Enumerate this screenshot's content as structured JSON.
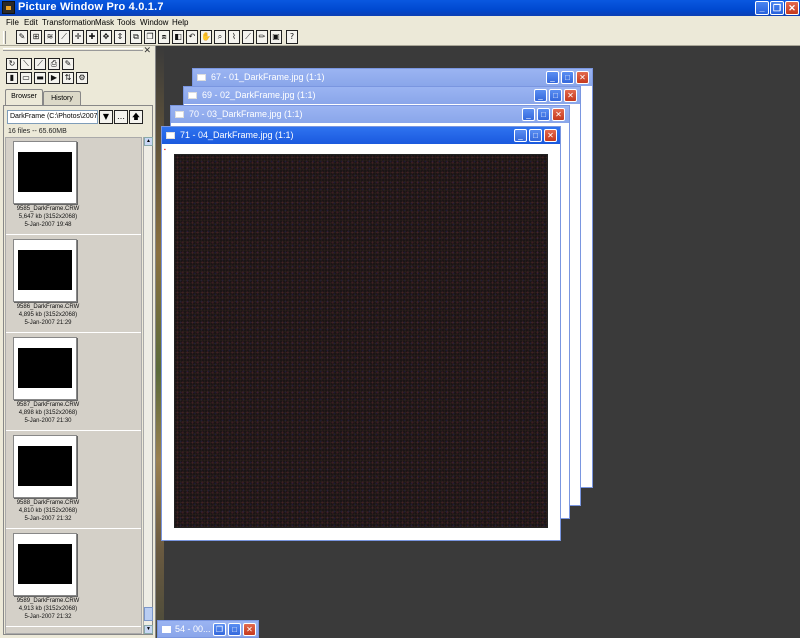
{
  "app": {
    "title": "Picture Window Pro 4.0.1.7"
  },
  "menu": [
    "File",
    "Edit",
    "Transformation",
    "Mask",
    "Tools",
    "Window",
    "Help"
  ],
  "toolbar_icons": [
    "pen-icon",
    "grid-icon",
    "wave-icon",
    "brush-icon",
    "cursor-icon",
    "plus-icon",
    "fit-icon",
    "range-icon",
    "layers-icon",
    "copy-icon",
    "stack-icon",
    "rotate-icon",
    "undo-icon",
    "hand-icon",
    "zoom-icon",
    "lasso-icon",
    "line-icon",
    "pencil-icon",
    "camera-icon",
    "help-icon"
  ],
  "toolbar_glyphs": [
    "✎",
    "⊞",
    "≋",
    "⟋",
    "✛",
    "✚",
    "✥",
    "⇕",
    "⧉",
    "❐",
    "⧈",
    "◧",
    "↶",
    "✋",
    "⌕",
    "⌇",
    "⟋",
    "✏",
    "▣",
    "?"
  ],
  "browser": {
    "tabs": [
      "Browser",
      "History"
    ],
    "folder": "DarkFrame (C:\\Photos\\2007",
    "file_count": "16 files -- 65.60MB",
    "files": [
      {
        "name": "9585_DarkFrame.CRW",
        "size": "5,647 kb (3152x2068)",
        "date": "5-Jan-2007 19:48"
      },
      {
        "name": "9586_DarkFrame.CRW",
        "size": "4,895 kb (3152x2068)",
        "date": "5-Jan-2007 21:29"
      },
      {
        "name": "9587_DarkFrame.CRW",
        "size": "4,898 kb (3152x2068)",
        "date": "5-Jan-2007 21:30"
      },
      {
        "name": "9588_DarkFrame.CRW",
        "size": "4,810 kb (3152x2068)",
        "date": "5-Jan-2007 21:32"
      },
      {
        "name": "9589_DarkFrame.CRW",
        "size": "4,913 kb (3152x2068)",
        "date": "5-Jan-2007 21:32"
      }
    ]
  },
  "windows": [
    {
      "title": "67 - 01_DarkFrame.jpg (1:1)",
      "active": false
    },
    {
      "title": "69 - 02_DarkFrame.jpg (1:1)",
      "active": false
    },
    {
      "title": "70 - 03_DarkFrame.jpg (1:1)",
      "active": false
    },
    {
      "title": "71 - 04_DarkFrame.jpg (1:1)",
      "active": true
    }
  ],
  "minimized_window": {
    "title": "54 - 00..."
  }
}
